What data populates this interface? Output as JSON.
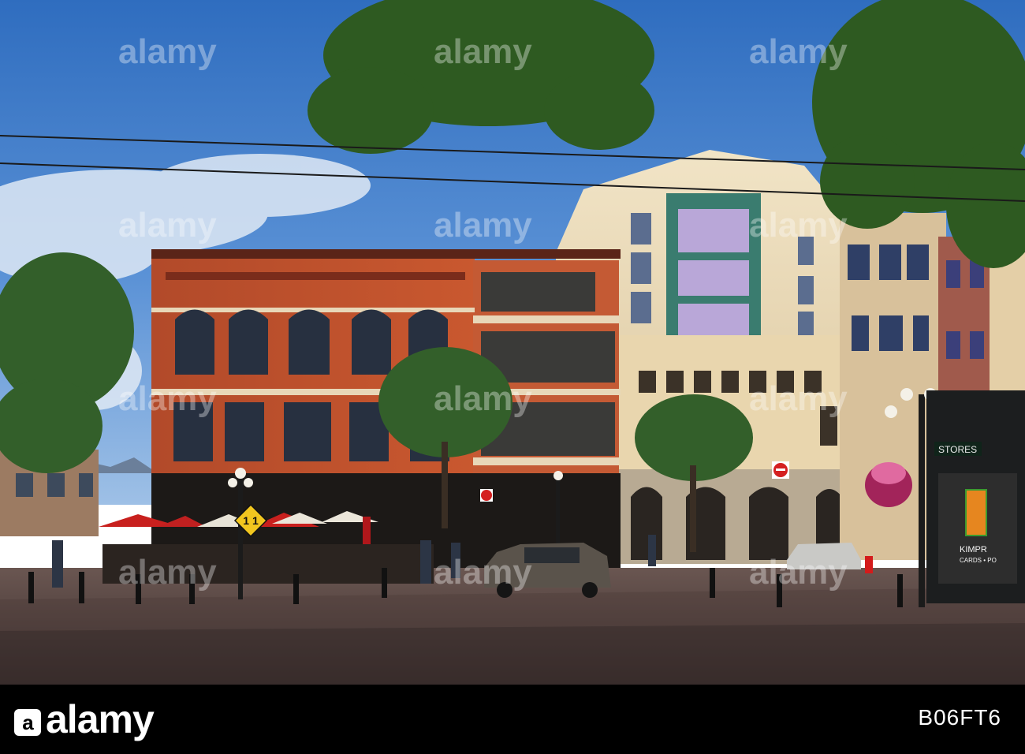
{
  "photo": {
    "description_visible_signs": {
      "store_sign": "STORES",
      "shop_sign_line1": "KIMPR",
      "shop_sign_line2": "CARDS • PO",
      "traffic_sign": "1 1"
    }
  },
  "watermarks": {
    "mark_text": "alamy"
  },
  "footer": {
    "brand": "alamy",
    "image_id": "B06FT6",
    "background_color": "#000000",
    "text_color": "#ffffff"
  }
}
